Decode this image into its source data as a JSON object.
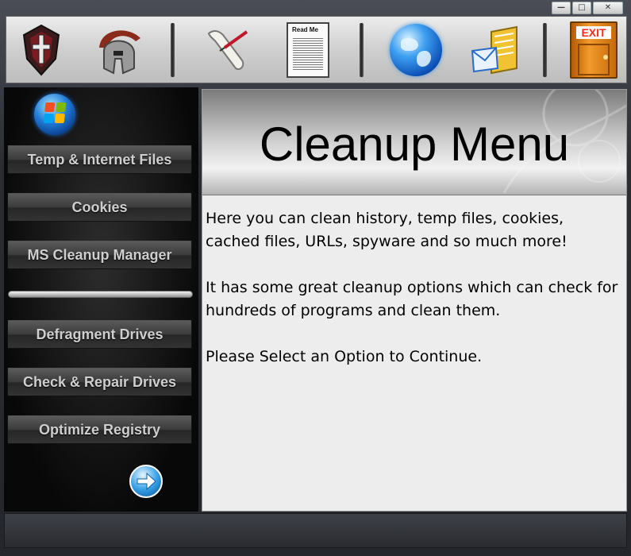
{
  "window_controls": {
    "minimize": "—",
    "restore": "□",
    "close": "✕"
  },
  "toolbar": {
    "icons": [
      {
        "name": "emblem-icon"
      },
      {
        "name": "spartan-helmet-icon"
      },
      {
        "name": "scroll-quill-icon"
      },
      {
        "name": "readme-document-icon",
        "label": "Read Me"
      },
      {
        "name": "globe-icon"
      },
      {
        "name": "mail-icon"
      },
      {
        "name": "exit-door-icon",
        "label": "EXIT"
      }
    ]
  },
  "sidebar": {
    "buttons": [
      "Temp & Internet Files",
      "Cookies",
      "MS Cleanup Manager",
      "Defragment Drives",
      "Check & Repair Drives",
      "Optimize Registry"
    ]
  },
  "panel": {
    "title": "Cleanup Menu",
    "paragraphs": [
      "Here you can clean history, temp files, cookies, cached files, URLs, spyware and so much more!",
      "It has some great cleanup options which can check for hundreds of programs and clean them.",
      "Please Select an Option to Continue."
    ]
  },
  "colors": {
    "accent_blue": "#1f7ad6",
    "exit_door": "#e07a12",
    "exit_text": "#ff2a1a"
  }
}
